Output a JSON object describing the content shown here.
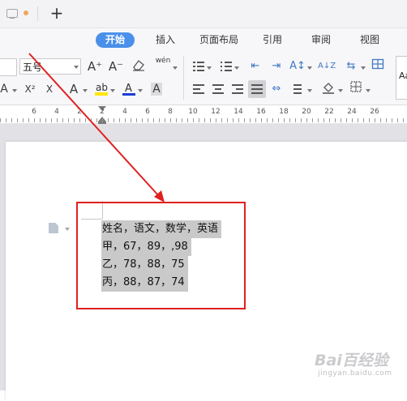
{
  "tabbar": {
    "new_tab_icon": "plus"
  },
  "ribbon": {
    "tabs": [
      {
        "label": "开始",
        "active": true
      },
      {
        "label": "插入",
        "active": false
      },
      {
        "label": "页面布局",
        "active": false
      },
      {
        "label": "引用",
        "active": false
      },
      {
        "label": "审阅",
        "active": false
      },
      {
        "label": "视图",
        "active": false
      }
    ],
    "accent_color": "#4a90ea"
  },
  "toolbar": {
    "font_size_value": "五号",
    "grow_font_label": "A⁺",
    "shrink_font_label": "A⁻",
    "phonetic_label": "wén",
    "superscript_label": "X²",
    "font_color_label": "A",
    "char_shading_label": "A",
    "style_preview_label": "Aa",
    "sort_label": "A↓Z"
  },
  "ruler": {
    "numbers": [
      "6",
      "4",
      "2",
      "2",
      "4",
      "6",
      "8",
      "10",
      "12",
      "14",
      "16",
      "18",
      "20",
      "22",
      "24",
      "26"
    ]
  },
  "document": {
    "lines": [
      "姓名，语文，数学，英语",
      "甲，67，89，,98",
      "乙，78，88，75",
      "丙，88，87，74"
    ]
  },
  "annotation": {
    "color": "#e02020"
  },
  "watermark": {
    "main": "Bai百经验",
    "sub": "jingyan.baidu.com"
  }
}
